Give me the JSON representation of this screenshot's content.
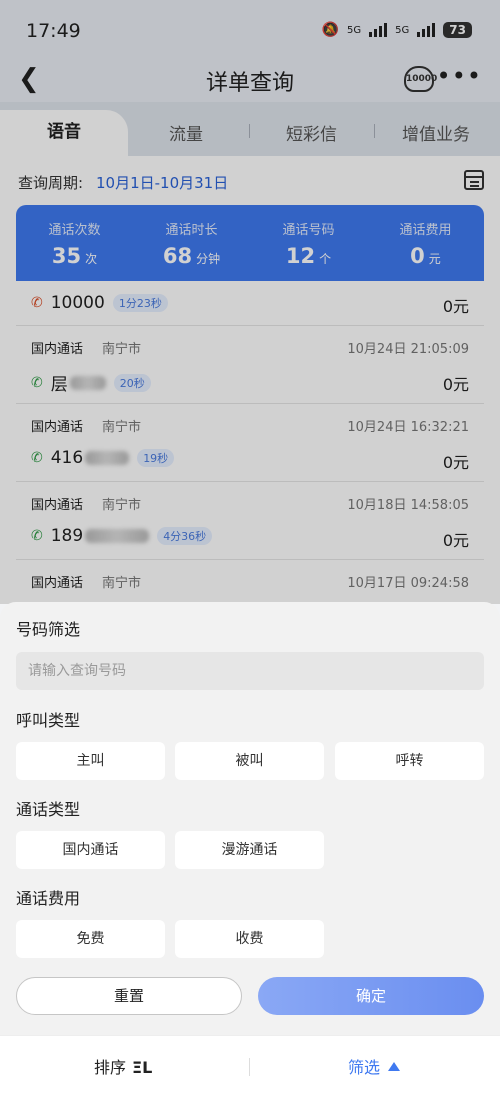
{
  "status": {
    "time": "17:49",
    "net1": "5G",
    "net2": "5G",
    "battery": "73"
  },
  "header": {
    "title": "详单查询",
    "service_icon": "service-hall-icon",
    "service_text": "10000"
  },
  "tabs": [
    "语音",
    "流量",
    "短彩信",
    "增值业务"
  ],
  "period": {
    "label": "查询周期:",
    "value": "10月1日-10月31日"
  },
  "summary": [
    {
      "label": "通话次数",
      "value": "35",
      "unit": "次"
    },
    {
      "label": "通话时长",
      "value": "68",
      "unit": "分钟"
    },
    {
      "label": "通话号码",
      "value": "12",
      "unit": "个"
    },
    {
      "label": "通话费用",
      "value": "0",
      "unit": "元"
    }
  ],
  "records": [
    {
      "type": "",
      "city": "",
      "time": "",
      "direction": "out",
      "number": "10000",
      "duration": "1分23秒",
      "fee": "0元"
    },
    {
      "type": "国内通话",
      "city": "南宁市",
      "time": "10月24日 21:05:09",
      "direction": "in",
      "number": "层",
      "duration": "20秒",
      "fee": "0元"
    },
    {
      "type": "国内通话",
      "city": "南宁市",
      "time": "10月24日 16:32:21",
      "direction": "in",
      "number": "416",
      "duration": "19秒",
      "fee": "0元"
    },
    {
      "type": "国内通话",
      "city": "南宁市",
      "time": "10月18日 14:58:05",
      "direction": "in",
      "number": "189",
      "duration": "4分36秒",
      "fee": "0元"
    },
    {
      "type": "国内通话",
      "city": "南宁市",
      "time": "10月17日 09:24:58",
      "direction": "in",
      "number": "",
      "duration": "",
      "fee": ""
    }
  ],
  "filter_sheet": {
    "number_filter": {
      "title": "号码筛选",
      "placeholder": "请输入查询号码"
    },
    "call_type": {
      "title": "呼叫类型",
      "options": [
        "主叫",
        "被叫",
        "呼转"
      ]
    },
    "talk_type": {
      "title": "通话类型",
      "options": [
        "国内通话",
        "漫游通话"
      ]
    },
    "fee_type": {
      "title": "通话费用",
      "options": [
        "免费",
        "收费"
      ]
    },
    "reset": "重置",
    "confirm": "确定"
  },
  "footer": {
    "sort": "排序",
    "sort_icon": "ΞL",
    "filter": "筛选"
  }
}
